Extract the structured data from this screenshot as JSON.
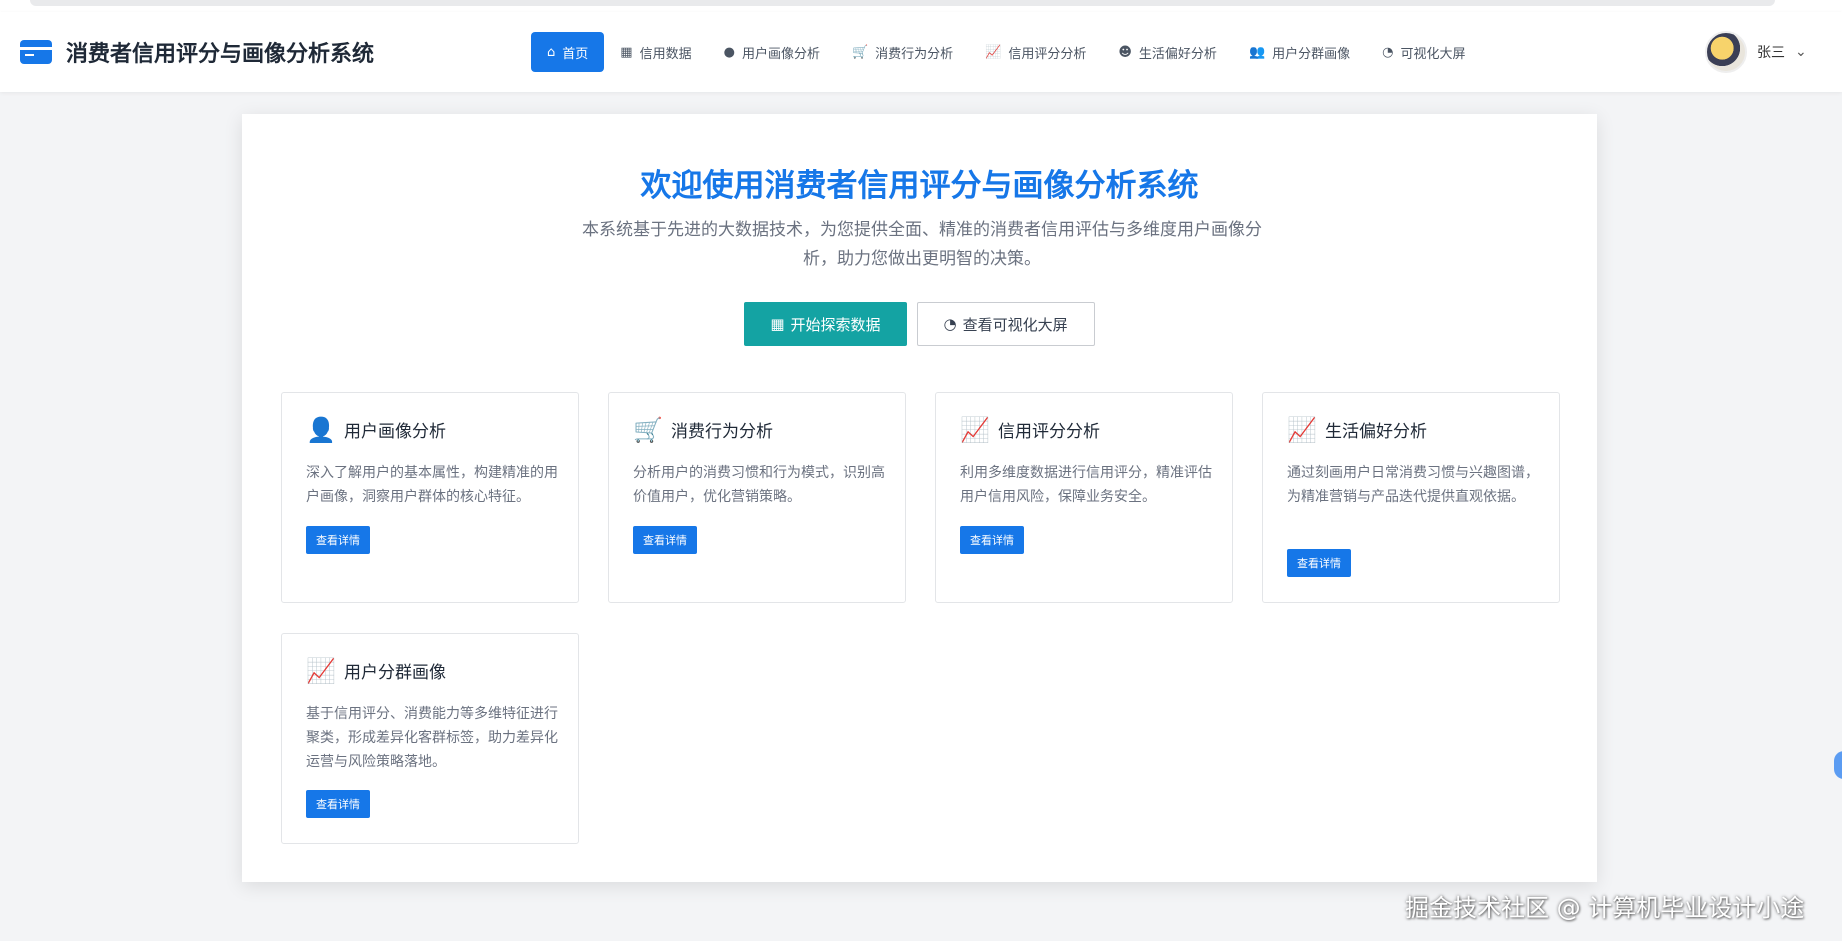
{
  "app": {
    "title": "消费者信用评分与画像分析系统"
  },
  "nav": {
    "items": [
      {
        "label": "首页",
        "icon": "home-icon",
        "glyph": "⌂",
        "active": true
      },
      {
        "label": "信用数据",
        "icon": "table-icon",
        "glyph": "▦"
      },
      {
        "label": "用户画像分析",
        "icon": "user-icon",
        "glyph": "●"
      },
      {
        "label": "消费行为分析",
        "icon": "cart-icon",
        "glyph": "🛒"
      },
      {
        "label": "信用评分分析",
        "icon": "line-chart-icon",
        "glyph": "📈"
      },
      {
        "label": "生活偏好分析",
        "icon": "smile-icon",
        "glyph": "☻"
      },
      {
        "label": "用户分群画像",
        "icon": "users-icon",
        "glyph": "👥"
      },
      {
        "label": "可视化大屏",
        "icon": "pie-chart-icon",
        "glyph": "◔"
      }
    ]
  },
  "user": {
    "name": "张三"
  },
  "hero": {
    "title": "欢迎使用消费者信用评分与画像分析系统",
    "description": "本系统基于先进的大数据技术，为您提供全面、精准的消费者信用评估与多维度用户画像分析，助力您做出更明智的决策。",
    "primary_button": "开始探索数据",
    "secondary_button": "查看可视化大屏"
  },
  "features": [
    {
      "title": "用户画像分析",
      "icon": "user-icon",
      "glyph": "👤",
      "description": "深入了解用户的基本属性，构建精准的用户画像，洞察用户群体的核心特征。",
      "button": "查看详情"
    },
    {
      "title": "消费行为分析",
      "icon": "cart-icon",
      "glyph": "🛒",
      "description": "分析用户的消费习惯和行为模式，识别高价值用户，优化营销策略。",
      "button": "查看详情"
    },
    {
      "title": "信用评分分析",
      "icon": "line-chart-icon",
      "glyph": "📈",
      "description": "利用多维度数据进行信用评分，精准评估用户信用风险，保障业务安全。",
      "button": "查看详情"
    },
    {
      "title": "生活偏好分析",
      "icon": "line-chart-icon",
      "glyph": "📈",
      "description": "通过刻画用户日常消费习惯与兴趣图谱，为精准营销与产品迭代提供直观依据。",
      "button": "查看详情"
    },
    {
      "title": "用户分群画像",
      "icon": "line-chart-icon",
      "glyph": "📈",
      "description": "基于信用评分、消费能力等多维特征进行聚类，形成差异化客群标签，助力差异化运营与风险策略落地。",
      "button": "查看详情"
    }
  ],
  "watermark": "掘金技术社区 @ 计算机毕业设计小途"
}
